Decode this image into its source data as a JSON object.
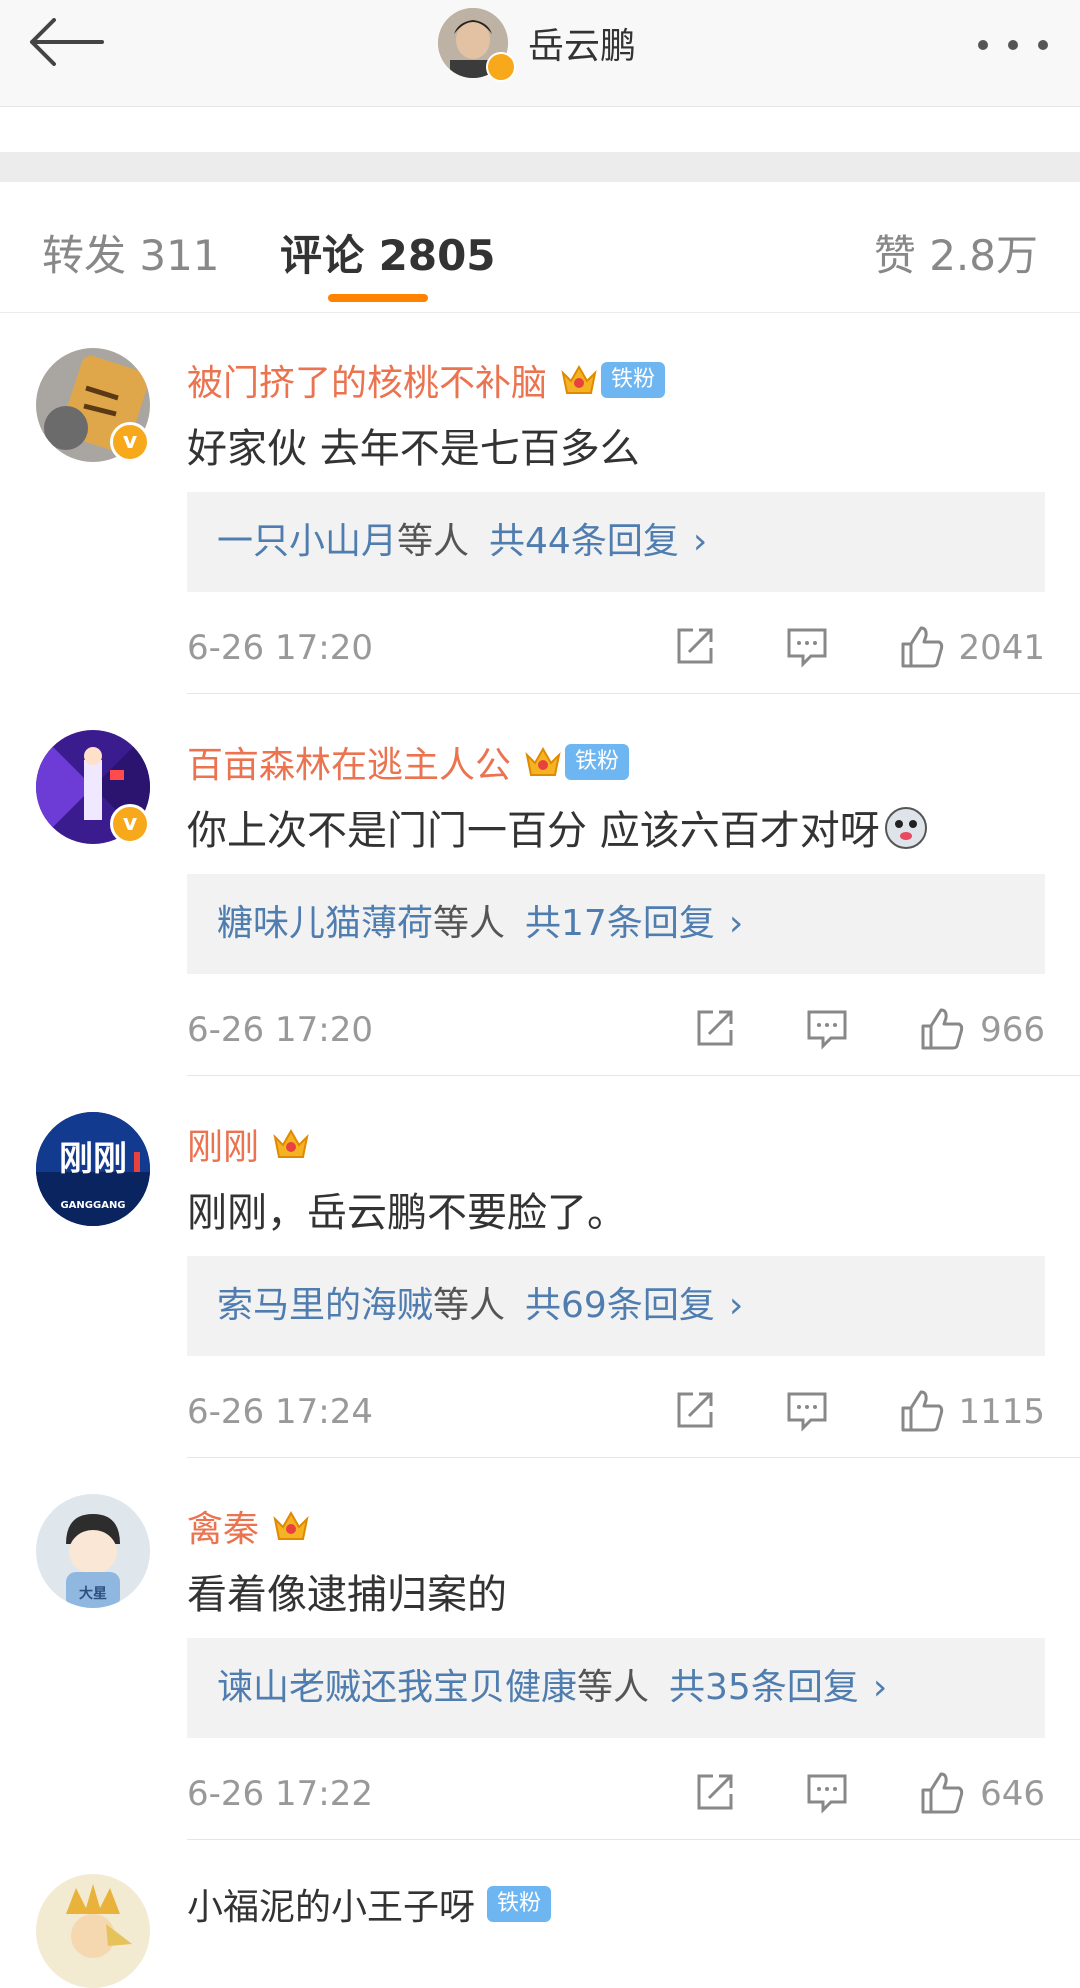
{
  "header": {
    "title": "岳云鹏"
  },
  "tabs": {
    "repost": "转发 311",
    "comments": "评论 2805",
    "likes": "赞 2.8万"
  },
  "comments": [
    {
      "name": "被门挤了的核桃不补脑",
      "badge": "铁粉",
      "text": "好家伙 去年不是七百多么",
      "reply_user": "一只小山月",
      "reply_mid": "等人",
      "reply_count": "共44条回复",
      "time": "6-26 17:20",
      "likes": "2041"
    },
    {
      "name": "百亩森林在逃主人公",
      "badge": "铁粉",
      "text": "你上次不是门门一百分 应该六百才对呀",
      "reply_user": "糖味儿猫薄荷",
      "reply_mid": "等人",
      "reply_count": "共17条回复",
      "time": "6-26 17:20",
      "likes": "966"
    },
    {
      "name": "刚刚",
      "text": "刚刚，岳云鹏不要脸了。",
      "reply_user": "索马里的海贼",
      "reply_mid": "等人",
      "reply_count": "共69条回复",
      "time": "6-26 17:24",
      "likes": "1115",
      "avatar_text": "刚刚",
      "avatar_subtext": "GANGGANG"
    },
    {
      "name": "禽秦",
      "text": "看着像逮捕归案的",
      "reply_user": "谏山老贼还我宝贝健康",
      "reply_mid": "等人",
      "reply_count": "共35条回复",
      "time": "6-26 17:22",
      "likes": "646",
      "avatar_text": "大星"
    },
    {
      "name": "小福泥的小王子呀",
      "badge": "铁粉"
    }
  ],
  "icons": {
    "back": "back-arrow-icon",
    "more": "more-icon",
    "share": "share-icon",
    "comment": "comment-icon",
    "like": "thumbs-up-icon",
    "crown": "crown-icon",
    "verified": "verified-icon"
  },
  "colors": {
    "accent": "#ff8200",
    "username": "#eb7350",
    "link": "#507daf",
    "badge_blue": "#6db6f2",
    "verified": "#f7a81b"
  }
}
